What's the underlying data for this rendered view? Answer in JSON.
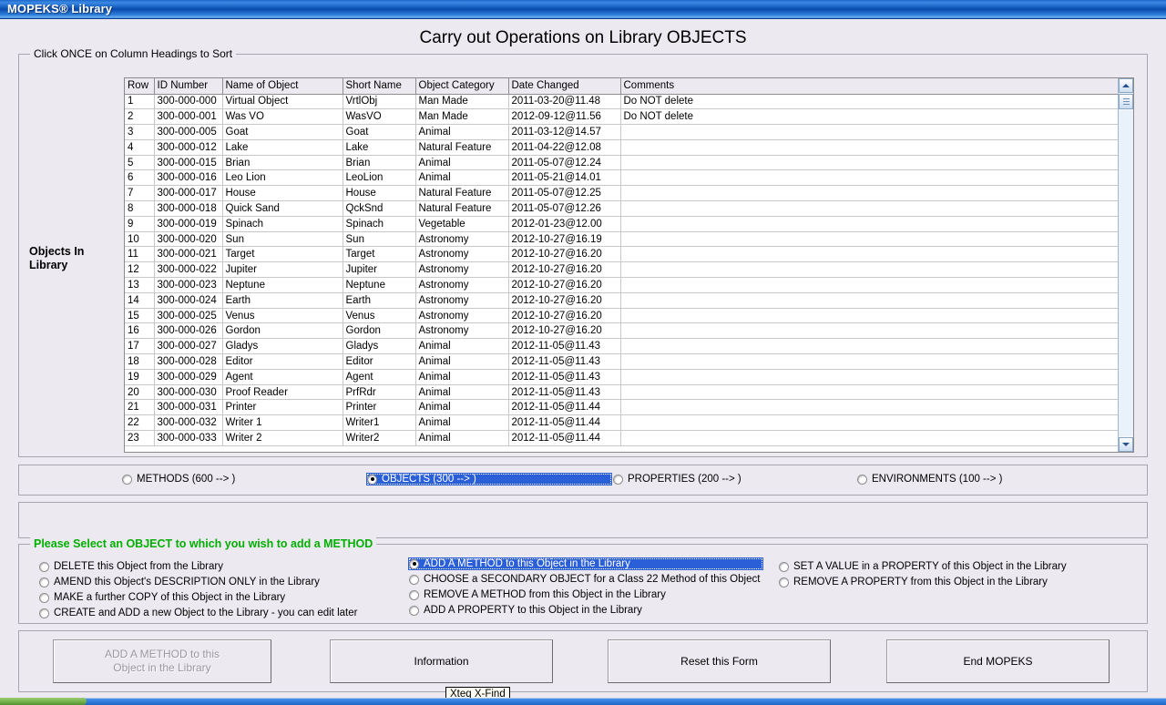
{
  "window": {
    "title": "MOPEKS® Library"
  },
  "page": {
    "heading": "Carry out Operations on Library OBJECTS"
  },
  "grid_group": {
    "legend": "Click ONCE on Column Headings to Sort"
  },
  "side_label": {
    "line1": "Objects In",
    "line2": "Library"
  },
  "table": {
    "columns": [
      "Row",
      "ID Number",
      "Name of Object",
      "Short Name",
      "Object Category",
      "Date Changed",
      "Comments"
    ],
    "rows": [
      [
        "1",
        "300-000-000",
        "Virtual Object",
        "VrtlObj",
        "Man Made",
        "2011-03-20@11.48",
        "Do NOT delete"
      ],
      [
        "2",
        "300-000-001",
        "Was VO",
        "WasVO",
        "Man Made",
        "2012-09-12@11.56",
        "Do NOT delete"
      ],
      [
        "3",
        "300-000-005",
        "Goat",
        "Goat",
        "Animal",
        "2011-03-12@14.57",
        ""
      ],
      [
        "4",
        "300-000-012",
        "Lake",
        "Lake",
        "Natural Feature",
        "2011-04-22@12.08",
        ""
      ],
      [
        "5",
        "300-000-015",
        "Brian",
        "Brian",
        "Animal",
        "2011-05-07@12.24",
        ""
      ],
      [
        "6",
        "300-000-016",
        "Leo Lion",
        "LeoLion",
        "Animal",
        "2011-05-21@14.01",
        ""
      ],
      [
        "7",
        "300-000-017",
        "House",
        "House",
        "Natural Feature",
        "2011-05-07@12.25",
        ""
      ],
      [
        "8",
        "300-000-018",
        "Quick Sand",
        "QckSnd",
        "Natural Feature",
        "2011-05-07@12.26",
        ""
      ],
      [
        "9",
        "300-000-019",
        "Spinach",
        "Spinach",
        "Vegetable",
        "2012-01-23@12.00",
        ""
      ],
      [
        "10",
        "300-000-020",
        "Sun",
        "Sun",
        "Astronomy",
        "2012-10-27@16.19",
        ""
      ],
      [
        "11",
        "300-000-021",
        "Target",
        "Target",
        "Astronomy",
        "2012-10-27@16.20",
        ""
      ],
      [
        "12",
        "300-000-022",
        "Jupiter",
        "Jupiter",
        "Astronomy",
        "2012-10-27@16.20",
        ""
      ],
      [
        "13",
        "300-000-023",
        "Neptune",
        "Neptune",
        "Astronomy",
        "2012-10-27@16.20",
        ""
      ],
      [
        "14",
        "300-000-024",
        "Earth",
        "Earth",
        "Astronomy",
        "2012-10-27@16.20",
        ""
      ],
      [
        "15",
        "300-000-025",
        "Venus",
        "Venus",
        "Astronomy",
        "2012-10-27@16.20",
        ""
      ],
      [
        "16",
        "300-000-026",
        "Gordon",
        "Gordon",
        "Astronomy",
        "2012-10-27@16.20",
        ""
      ],
      [
        "17",
        "300-000-027",
        "Gladys",
        "Gladys",
        "Animal",
        "2012-11-05@11.43",
        ""
      ],
      [
        "18",
        "300-000-028",
        "Editor",
        "Editor",
        "Animal",
        "2012-11-05@11.43",
        ""
      ],
      [
        "19",
        "300-000-029",
        "Agent",
        "Agent",
        "Animal",
        "2012-11-05@11.43",
        ""
      ],
      [
        "20",
        "300-000-030",
        "Proof Reader",
        "PrfRdr",
        "Animal",
        "2012-11-05@11.43",
        ""
      ],
      [
        "21",
        "300-000-031",
        "Printer",
        "Printer",
        "Animal",
        "2012-11-05@11.44",
        ""
      ],
      [
        "22",
        "300-000-032",
        "Writer 1",
        "Writer1",
        "Animal",
        "2012-11-05@11.44",
        ""
      ],
      [
        "23",
        "300-000-033",
        "Writer 2",
        "Writer2",
        "Animal",
        "2012-11-05@11.44",
        ""
      ]
    ]
  },
  "kind_radios": [
    {
      "label": "METHODS (600 --> )",
      "selected": false
    },
    {
      "label": "OBJECTS (300 --> )",
      "selected": true
    },
    {
      "label": "PROPERTIES (200 --> )",
      "selected": false
    },
    {
      "label": "ENVIRONMENTS (100 --> )",
      "selected": false
    }
  ],
  "action_group": {
    "legend": "Please Select an OBJECT to which you wish to add a METHOD",
    "column1": [
      {
        "label": "DELETE this Object from the Library",
        "selected": false
      },
      {
        "label": "AMEND this Object's DESCRIPTION ONLY in the Library",
        "selected": false
      },
      {
        "label": "MAKE a further COPY of this Object in the Library",
        "selected": false
      },
      {
        "label": "CREATE and ADD a new Object to the Library - you can edit later",
        "selected": false
      }
    ],
    "column2": [
      {
        "label": "ADD A METHOD to this Object in the Library",
        "selected": true
      },
      {
        "label": "CHOOSE a SECONDARY OBJECT for a Class 22 Method of this Object",
        "selected": false
      },
      {
        "label": "REMOVE A METHOD from this Object in the Library",
        "selected": false
      },
      {
        "label": "ADD A PROPERTY to this Object in the Library",
        "selected": false
      }
    ],
    "column3": [
      {
        "label": "SET A VALUE in a PROPERTY of this Object in the Library",
        "selected": false
      },
      {
        "label": "REMOVE A PROPERTY from this Object in the Library",
        "selected": false
      }
    ]
  },
  "buttons": {
    "add_method_line1": "ADD A METHOD to this",
    "add_method_line2": "Object in the Library",
    "information": "Information",
    "reset": "Reset this Form",
    "end": "End MOPEKS"
  },
  "tooltip": {
    "text": "Xteq X-Find"
  },
  "colors": {
    "titlebar_blue": "#0e54b8",
    "selection_blue": "#2a5fd8",
    "legend_green": "#00b000",
    "form_background": "#ece9f0"
  }
}
